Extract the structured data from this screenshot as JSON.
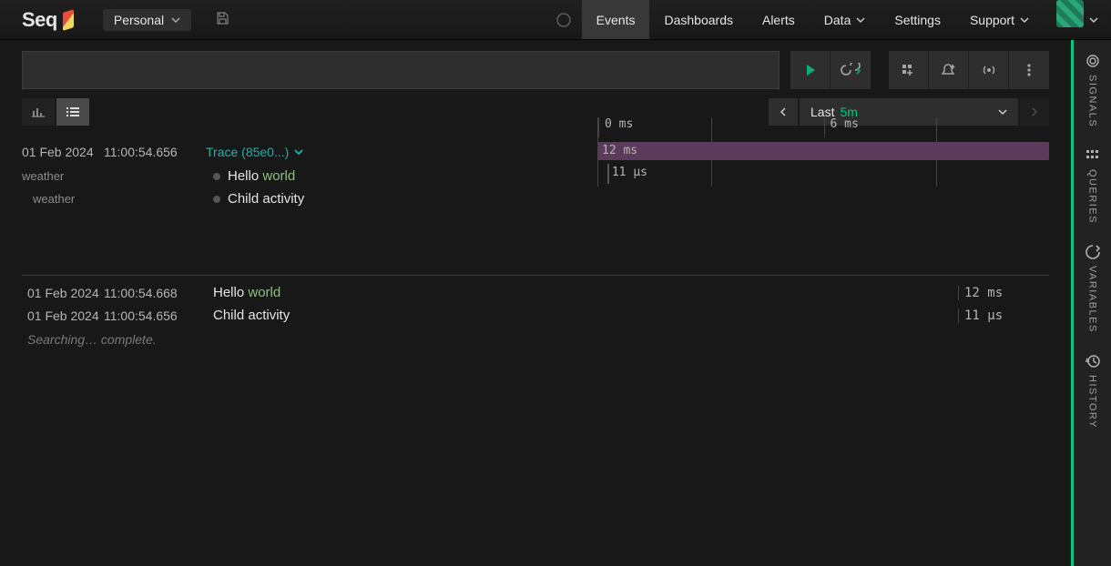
{
  "app": {
    "name": "Seq"
  },
  "workspace": {
    "label": "Personal"
  },
  "nav": {
    "events": "Events",
    "dashboards": "Dashboards",
    "alerts": "Alerts",
    "data": "Data",
    "settings": "Settings",
    "support": "Support"
  },
  "sidebar": {
    "signals": "SIGNALS",
    "queries": "QUERIES",
    "variables": "VARIABLES",
    "history": "HISTORY"
  },
  "search": {
    "value": ""
  },
  "range": {
    "prefix": "Last",
    "value": "5m"
  },
  "trace": {
    "date": "01 Feb 2024",
    "time": "11:00:54.656",
    "title": "Trace (85e0...)",
    "ticks": [
      "0 ms",
      "6 ms"
    ],
    "rows": [
      {
        "service": "weather",
        "indent": 0,
        "text_pre": "Hello ",
        "text_hl": "world",
        "text_post": "",
        "duration": "12 ms",
        "bar_left_pct": 0,
        "bar_width_pct": 100,
        "kind": "root"
      },
      {
        "service": "weather",
        "indent": 1,
        "text_pre": "Child activity",
        "text_hl": "",
        "text_post": "",
        "duration": "11 µs",
        "bar_left_pct": 2,
        "bar_width_pct": 0.4,
        "kind": "child"
      }
    ]
  },
  "events": {
    "rows": [
      {
        "date": "01 Feb 2024",
        "time": "11:00:54.668",
        "msg_pre": "Hello ",
        "msg_hl": "world",
        "msg_post": "",
        "dur": "12 ms"
      },
      {
        "date": "01 Feb 2024",
        "time": "11:00:54.656",
        "msg_pre": "Child activity",
        "msg_hl": "",
        "msg_post": "",
        "dur": "11 µs"
      }
    ],
    "status": "Searching… complete."
  },
  "icons": {
    "play": "play-icon",
    "tail": "tail-icon",
    "add_signal": "add-signal-icon",
    "create_alert": "create-alert-icon",
    "stream": "stream-icon",
    "more": "more-icon",
    "chart": "chart-icon",
    "list": "list-icon",
    "prev": "prev-icon",
    "next": "next-icon",
    "moon": "moon-icon",
    "save": "save-icon"
  }
}
